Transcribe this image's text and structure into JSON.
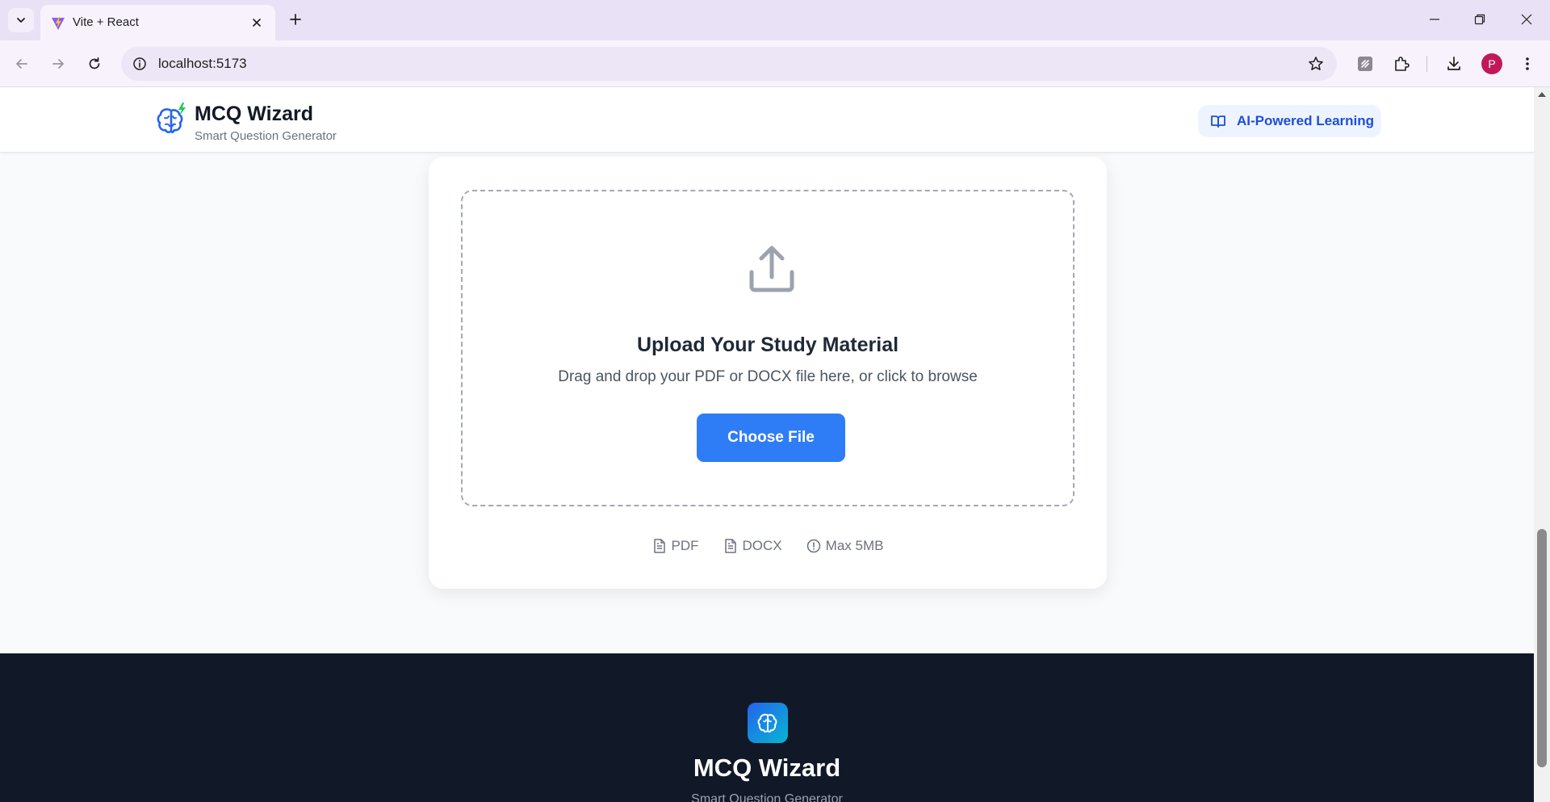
{
  "browser": {
    "tab_title": "Vite + React",
    "url": "localhost:5173",
    "profile_initial": "P"
  },
  "header": {
    "brand_name": "MCQ Wizard",
    "brand_tagline": "Smart Question Generator",
    "badge_label": "AI-Powered Learning"
  },
  "upload": {
    "title": "Upload Your Study Material",
    "subtitle": "Drag and drop your PDF or DOCX file here, or click to browse",
    "button_label": "Choose File",
    "formats": [
      {
        "label": "PDF",
        "icon": "file-text-icon"
      },
      {
        "label": "DOCX",
        "icon": "file-text-icon"
      },
      {
        "label": "Max 5MB",
        "icon": "alert-circle-icon"
      }
    ]
  },
  "footer": {
    "brand_name": "MCQ Wizard",
    "brand_tagline": "Smart Question Generator"
  },
  "colors": {
    "primary": "#2f7df6",
    "badge_text": "#1d4ed8",
    "badge_bg": "#eef4ff",
    "footer_bg": "#111827",
    "logo_green": "#22c55e"
  }
}
